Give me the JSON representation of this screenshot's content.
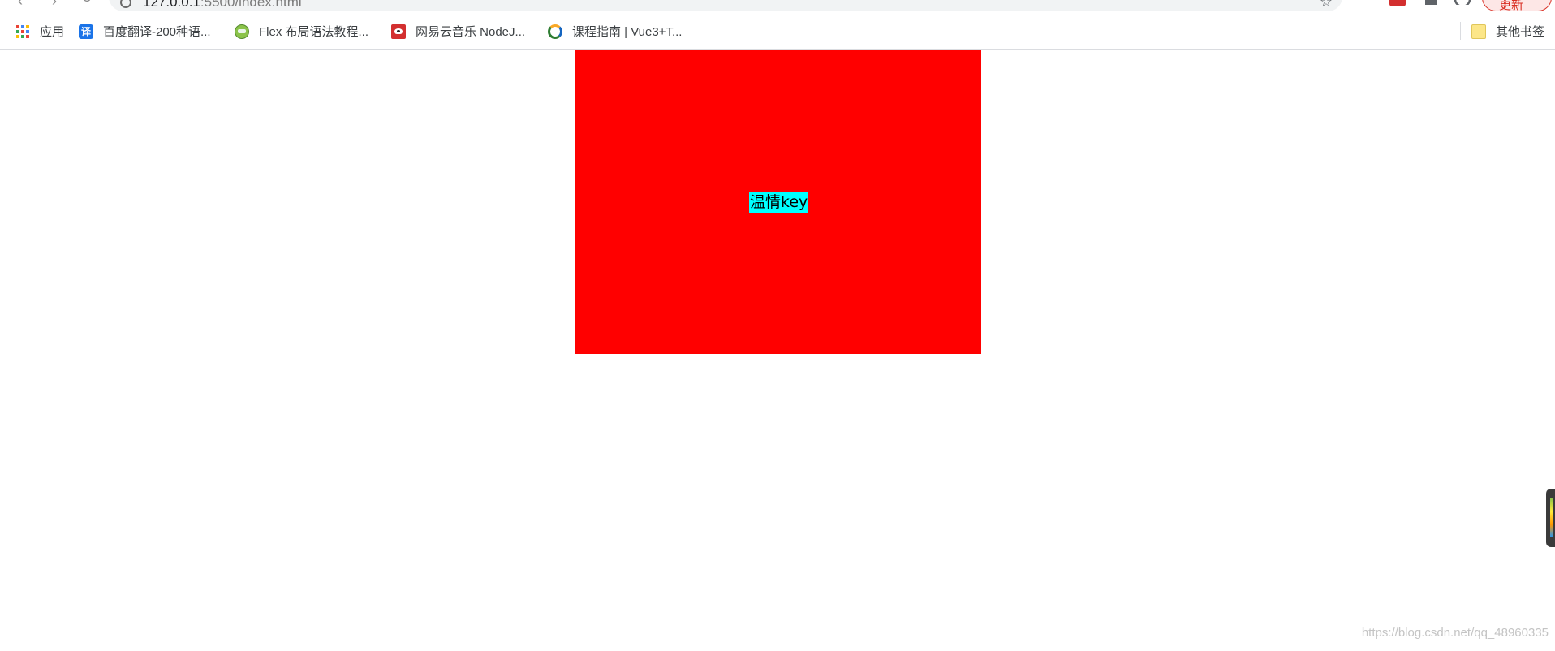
{
  "toolbar": {
    "url_host": "127.0.0.1",
    "url_rest": ":5500/index.html",
    "update_label": "更新",
    "update_menu": "⋮"
  },
  "bookmarks": {
    "items": [
      {
        "label": "应用",
        "icon": "apps-grid-icon"
      },
      {
        "label": "百度翻译-200种语...",
        "icon": "baidu-translate-icon"
      },
      {
        "label": "Flex 布局语法教程...",
        "icon": "flex-tutorial-icon"
      },
      {
        "label": "网易云音乐 NodeJ...",
        "icon": "netease-music-icon"
      },
      {
        "label": "课程指南 | Vue3+T...",
        "icon": "course-guide-icon"
      }
    ],
    "other_bookmarks": "其他书签"
  },
  "content": {
    "box_color": "#ff0000",
    "text": "温情key",
    "text_highlight": "#00ffff"
  },
  "watermark": "https://blog.csdn.net/qq_48960335"
}
